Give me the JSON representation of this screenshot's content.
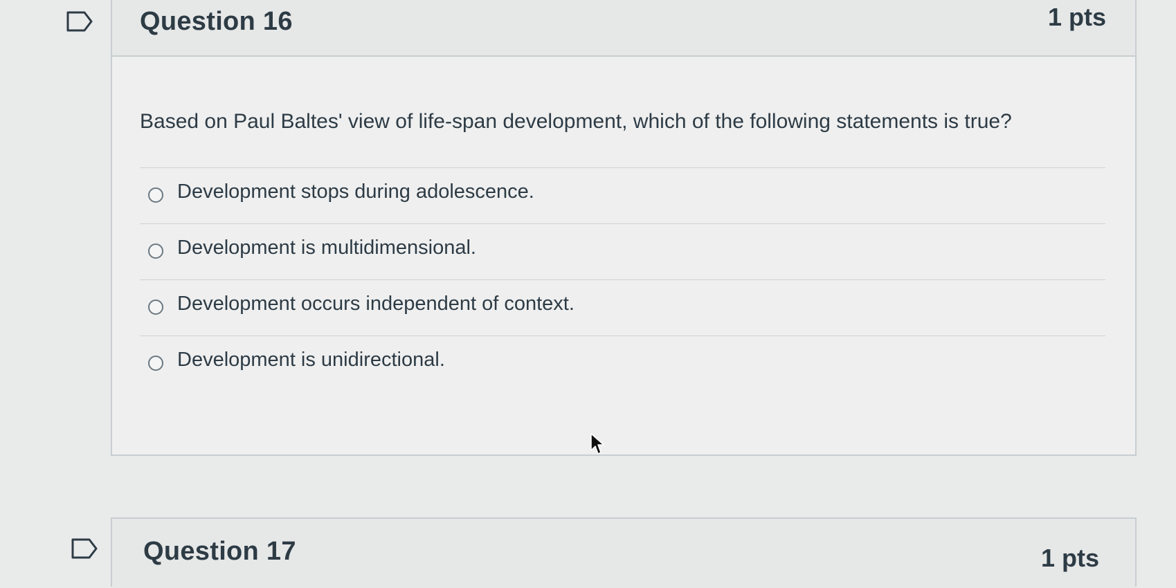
{
  "question16": {
    "title": "Question 16",
    "points": "1 pts",
    "text": "Based on Paul Baltes' view of life-span development, which of the following statements is true?",
    "answers": [
      "Development stops during adolescence.",
      "Development is multidimensional.",
      "Development occurs independent of context.",
      "Development is unidirectional."
    ]
  },
  "question17": {
    "title": "Question 17",
    "points": "1 pts"
  },
  "icons": {
    "flag": "flag-question-icon",
    "cursor": "mouse-pointer-icon",
    "radio": "radio-button-unselected"
  },
  "colors": {
    "text": "#2d3b45",
    "border": "#c7cdd1",
    "background": "#e9eaea"
  }
}
